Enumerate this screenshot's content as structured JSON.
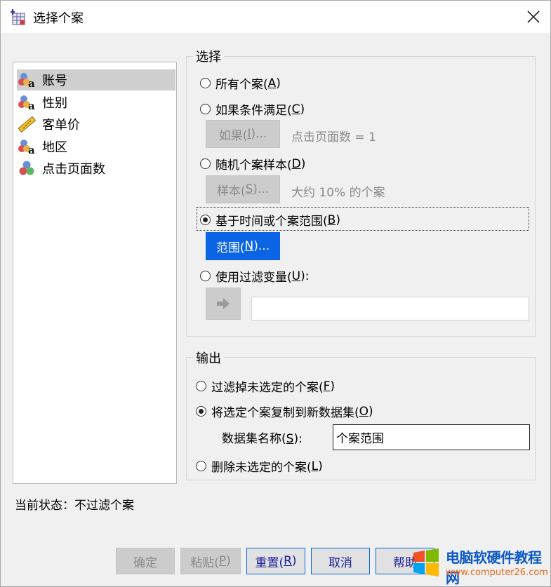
{
  "window": {
    "title": "选择个案"
  },
  "variables": [
    {
      "label": "账号",
      "icon": "nominal-string-icon"
    },
    {
      "label": "性别",
      "icon": "nominal-string-icon"
    },
    {
      "label": "客单价",
      "icon": "scale-ruler-icon"
    },
    {
      "label": "地区",
      "icon": "nominal-string-icon"
    },
    {
      "label": "点击页面数",
      "icon": "nominal-numeric-icon"
    }
  ],
  "select_group": {
    "title": "选择",
    "all_cases": {
      "label": "所有个案(",
      "key": "A",
      "suffix": ")"
    },
    "if_condition": {
      "label": "如果条件满足(",
      "key": "C",
      "suffix": ")"
    },
    "if_button": {
      "label": "如果(",
      "key": "I",
      "suffix": ")..."
    },
    "if_hint": "点击页面数 = 1",
    "random_sample": {
      "label": "随机个案样本(",
      "key": "D",
      "suffix": ")"
    },
    "sample_button": {
      "label": "样本(",
      "key": "S",
      "suffix": ")..."
    },
    "sample_hint": "大约 10% 的个案",
    "time_range": {
      "label": "基于时间或个案范围(",
      "key": "B",
      "suffix": ")"
    },
    "range_button": {
      "label": "范围(",
      "key": "N",
      "suffix": ")..."
    },
    "filter_variable": {
      "label": "使用过滤变量(",
      "key": "U",
      "suffix": "):"
    },
    "selected_option": "time_range"
  },
  "output_group": {
    "title": "输出",
    "filter_out": {
      "label": "过滤掉未选定的个案(",
      "key": "F",
      "suffix": ")"
    },
    "copy_new": {
      "label": "将选定个案复制到新数据集(",
      "key": "O",
      "suffix": ")"
    },
    "dataset_name_label": {
      "label": "数据集名称(",
      "key": "S",
      "suffix": "):"
    },
    "dataset_name_value": "个案范围",
    "delete_unselected": {
      "label": "删除未选定的个案(",
      "key": "L",
      "suffix": ")"
    },
    "selected_option": "copy_new"
  },
  "status": "当前状态：不过滤个案",
  "buttons": {
    "ok": "确定",
    "paste": {
      "label": "粘贴(",
      "key": "P",
      "suffix": ")"
    },
    "reset": {
      "label": "重置(",
      "key": "R",
      "suffix": ")"
    },
    "cancel": "取消",
    "help": "帮助"
  },
  "watermark": {
    "title": "电脑软硬件教程网",
    "url": "www.computer26.com"
  },
  "colors": {
    "accent": "#0a64e4",
    "disabled_text": "#8a8a8a",
    "selected_row": "#cfcfcf"
  }
}
